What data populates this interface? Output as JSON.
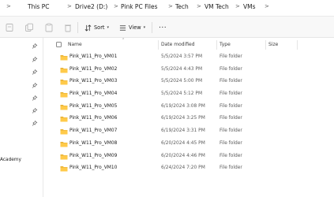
{
  "breadcrumb": [
    {
      "label": "This PC"
    },
    {
      "label": "Drive2 (D:)"
    },
    {
      "label": "Pink PC Files"
    },
    {
      "label": "Tech"
    },
    {
      "label": "VM Tech"
    },
    {
      "label": "VMs"
    }
  ],
  "toolbar": {
    "sort_label": "Sort",
    "view_label": "View",
    "more_label": "..."
  },
  "nav": {
    "partial_label": "Academy"
  },
  "columns": {
    "name": "Name",
    "date": "Date modified",
    "type": "Type",
    "size": "Size"
  },
  "files": [
    {
      "name": "Pink_W11_Pro_VM01",
      "date": "5/5/2024 3:57 PM",
      "type": "File folder"
    },
    {
      "name": "Pink_W11_Pro_VM02",
      "date": "5/5/2024 4:43 PM",
      "type": "File folder"
    },
    {
      "name": "Pink_W11_Pro_VM03",
      "date": "5/5/2024 5:00 PM",
      "type": "File folder"
    },
    {
      "name": "Pink_W11_Pro_VM04",
      "date": "5/5/2024 5:12 PM",
      "type": "File folder"
    },
    {
      "name": "Pink_W11_Pro_VM05",
      "date": "6/19/2024 3:08 PM",
      "type": "File folder"
    },
    {
      "name": "Pink_W11_Pro_VM06",
      "date": "6/19/2024 3:25 PM",
      "type": "File folder"
    },
    {
      "name": "Pink_W11_Pro_VM07",
      "date": "6/19/2024 3:31 PM",
      "type": "File folder"
    },
    {
      "name": "Pink_W11_Pro_VM08",
      "date": "6/20/2024 4:45 PM",
      "type": "File folder"
    },
    {
      "name": "Pink_W11_Pro_VM09",
      "date": "6/20/2024 4:46 PM",
      "type": "File folder"
    },
    {
      "name": "Pink_W11_Pro_VM10",
      "date": "6/24/2024 7:20 PM",
      "type": "File folder"
    }
  ]
}
